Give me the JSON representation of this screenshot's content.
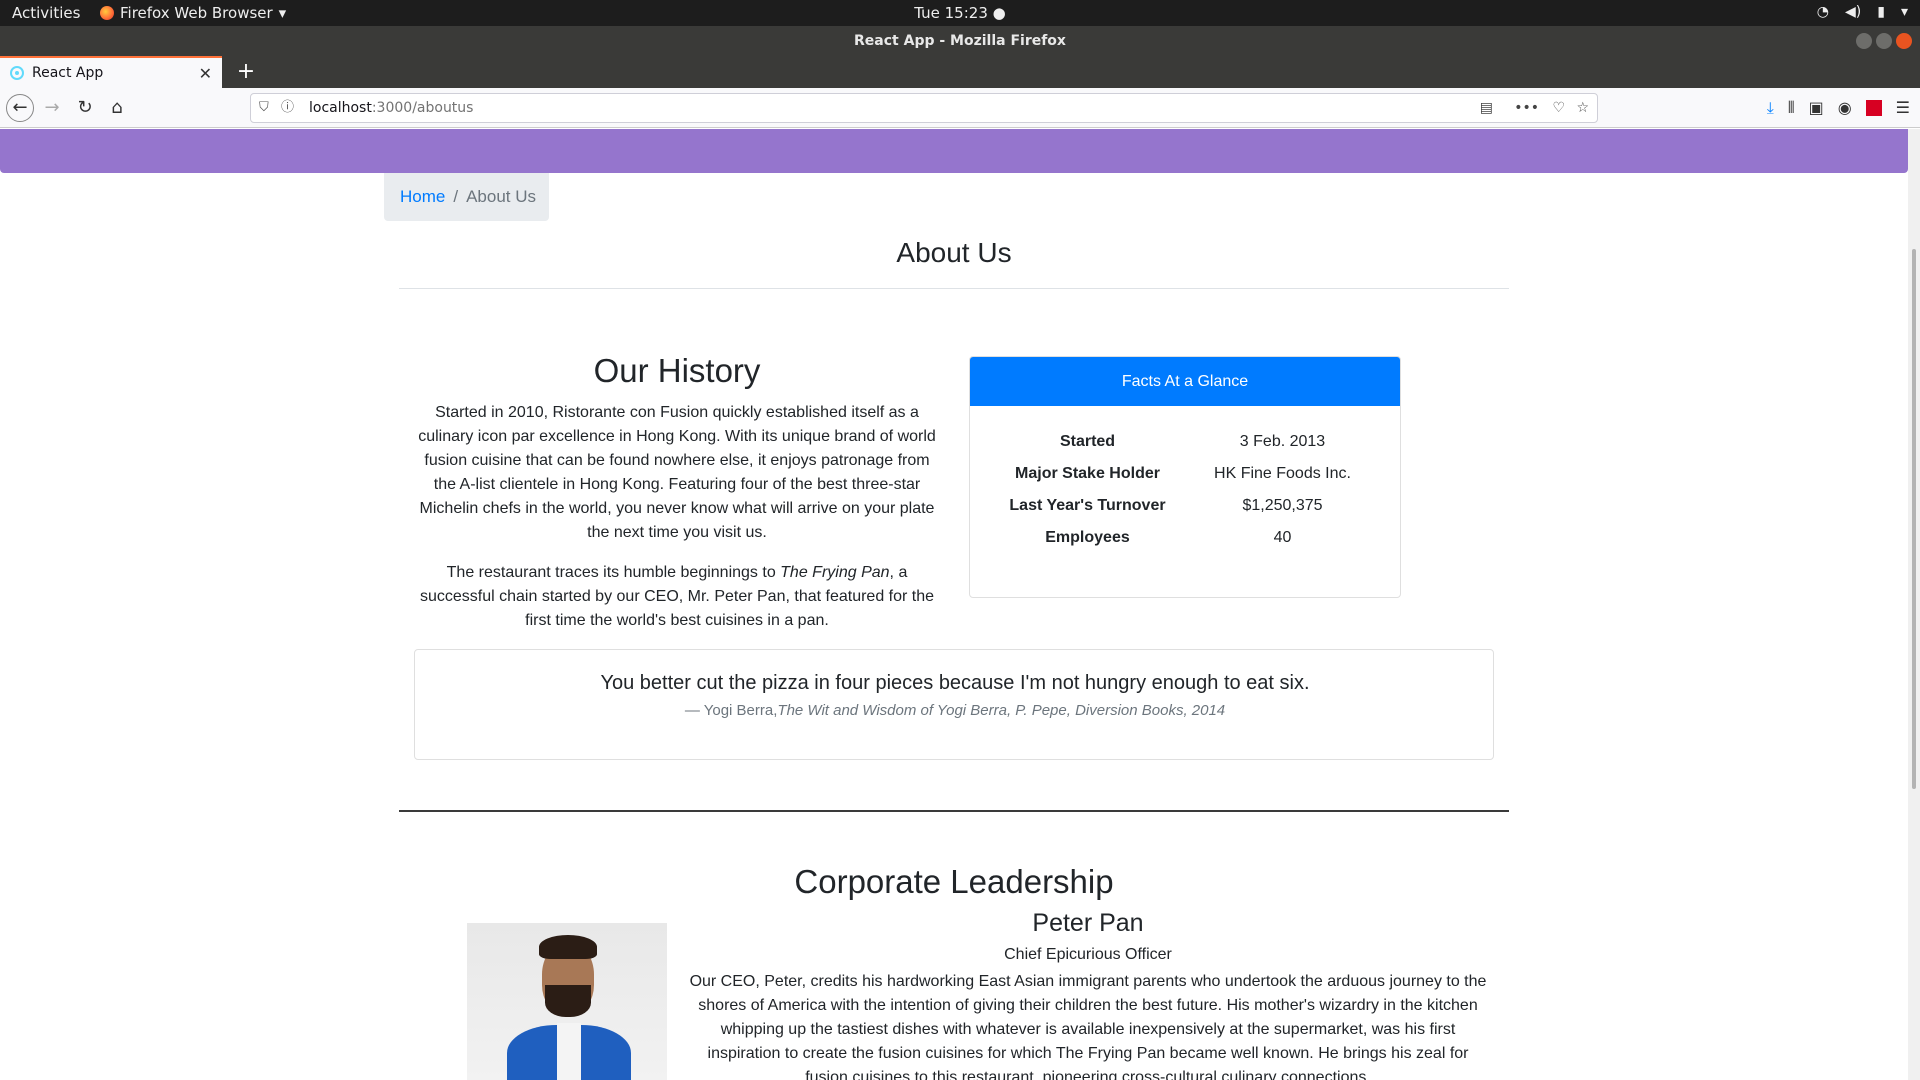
{
  "desktop": {
    "activities": "Activities",
    "app_name": "Firefox Web Browser",
    "clock": "Tue 15:23 ●"
  },
  "browser": {
    "window_title": "React App - Mozilla Firefox",
    "tab_title": "React App",
    "url_host": "localhost",
    "url_path": ":3000/aboutus",
    "new_tab": "+",
    "tab_close": "✕"
  },
  "breadcrumb": {
    "home": "Home",
    "separator": "/",
    "current": "About Us"
  },
  "page": {
    "title": "About Us"
  },
  "history": {
    "heading": "Our History",
    "paragraph1": "Started in 2010, Ristorante con Fusion quickly established itself as a culinary icon par excellence in Hong Kong. With its unique brand of world fusion cuisine that can be found nowhere else, it enjoys patronage from the A-list clientele in Hong Kong. Featuring four of the best three-star Michelin chefs in the world, you never know what will arrive on your plate the next time you visit us.",
    "paragraph2_before": "The restaurant traces its humble beginnings to ",
    "paragraph2_italic": "The Frying Pan",
    "paragraph2_after": ", a successful chain started by our CEO, Mr. Peter Pan, that featured for the first time the world's best cuisines in a pan."
  },
  "facts": {
    "header": "Facts At a Glance",
    "rows": [
      {
        "key": "Started",
        "value": "3 Feb. 2013"
      },
      {
        "key": "Major Stake Holder",
        "value": "HK Fine Foods Inc."
      },
      {
        "key": "Last Year's Turnover",
        "value": "$1,250,375"
      },
      {
        "key": "Employees",
        "value": "40"
      }
    ]
  },
  "quote": {
    "text": "You better cut the pizza in four pieces because I'm not hungry enough to eat six.",
    "author": "— Yogi Berra,",
    "source": "The Wit and Wisdom of Yogi Berra, P. Pepe, Diversion Books, 2014"
  },
  "leadership": {
    "heading": "Corporate Leadership",
    "leader": {
      "name": "Peter Pan",
      "role": "Chief Epicurious Officer",
      "bio": "Our CEO, Peter, credits his hardworking East Asian immigrant parents who undertook the arduous journey to the shores of America with the intention of giving their children the best future. His mother's wizardry in the kitchen whipping up the tastiest dishes with whatever is available inexpensively at the supermarket, was his first inspiration to create the fusion cuisines for which The Frying Pan became well known. He brings his zeal for fusion cuisines to this restaurant, pioneering cross-cultural culinary connections."
    }
  },
  "colors": {
    "header_purple": "#9575cd",
    "primary_blue": "#007bff",
    "breadcrumb_bg": "#e9ecef"
  }
}
